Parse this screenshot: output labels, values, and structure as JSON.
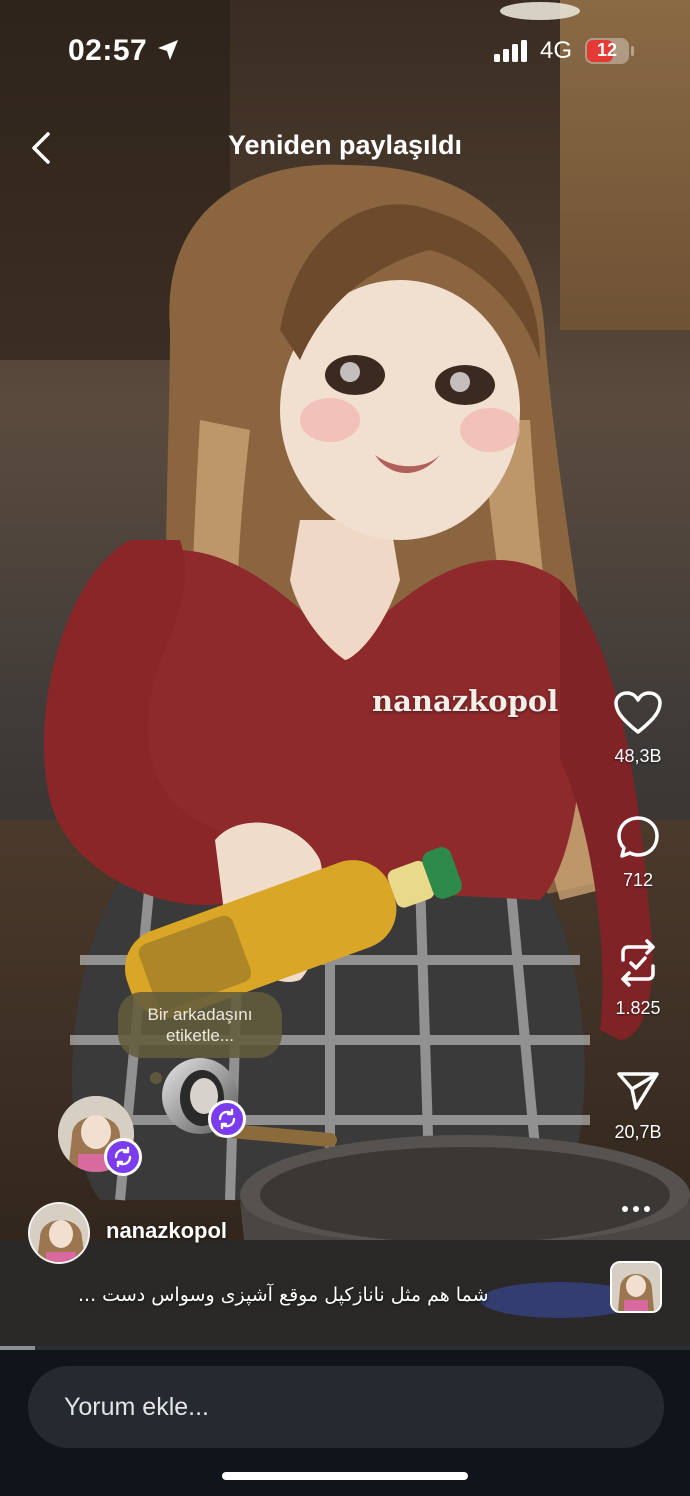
{
  "status_bar": {
    "time": "02:57",
    "network": "4G",
    "battery": "12",
    "battery_level": 0.12,
    "battery_color": "#e53935"
  },
  "header": {
    "title": "Yeniden paylaşıldı",
    "back_icon": "chevron-left-icon"
  },
  "video": {
    "watermark": "nanazkopol",
    "progress": 0.05
  },
  "actions": [
    {
      "icon": "heart-icon",
      "count": "48,3B"
    },
    {
      "icon": "comment-icon",
      "count": "712"
    },
    {
      "icon": "repost-icon",
      "count": "1.825"
    },
    {
      "icon": "send-icon",
      "count": "20,7B"
    }
  ],
  "tag_prompt": "Bir arkadaşını etiketle...",
  "post": {
    "username": "nanazkopol",
    "caption": "شما هم مثل نانازکپل موقع آشپزی وسواس دست ..."
  },
  "comment": {
    "placeholder": "Yorum ekle..."
  },
  "colors": {
    "accent_purple": "#7b3cf0",
    "bottom_bar": "#10151b",
    "input_bg": "#252a31"
  }
}
